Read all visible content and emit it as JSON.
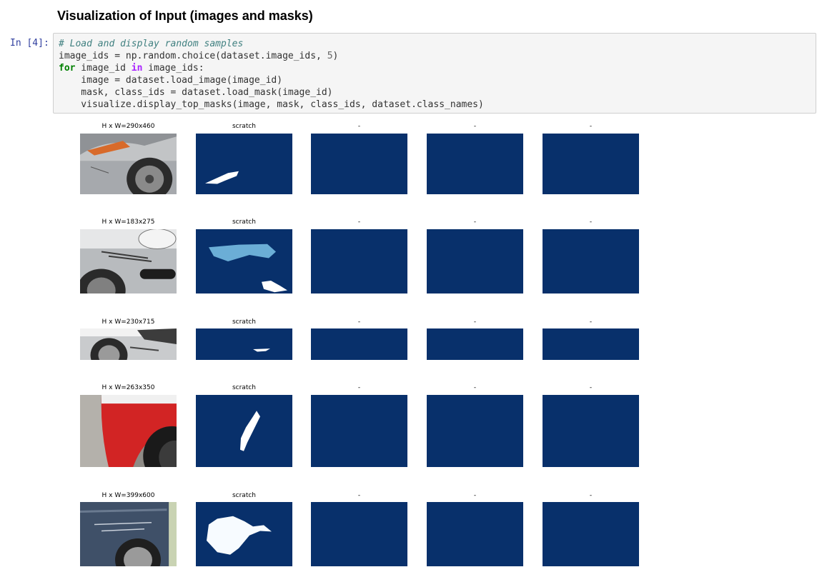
{
  "heading": "Visualization of Input (images and masks)",
  "cell": {
    "prompt": "In [4]:",
    "lines": [
      [
        {
          "t": "# Load and display random samples",
          "c": "tok-comment"
        }
      ],
      [
        {
          "t": "image_ids = np.random.choice(dataset.image_ids, ",
          "c": ""
        },
        {
          "t": "5",
          "c": "tok-num"
        },
        {
          "t": ")",
          "c": ""
        }
      ],
      [
        {
          "t": "for",
          "c": "tok-kw"
        },
        {
          "t": " image_id ",
          "c": ""
        },
        {
          "t": "in",
          "c": "tok-op"
        },
        {
          "t": " image_ids:",
          "c": ""
        }
      ],
      [
        {
          "t": "    image = dataset.load_image(image_id)",
          "c": ""
        }
      ],
      [
        {
          "t": "    mask, class_ids = dataset.load_mask(image_id)",
          "c": ""
        }
      ],
      [
        {
          "t": "    visualize.display_top_masks(image, mask, class_ids, dataset.class_names)",
          "c": ""
        }
      ]
    ]
  },
  "colors": {
    "mask_background": "#08306b",
    "mask_white": "#ffffff",
    "mask_light_blue": "#6baed6"
  },
  "rows": [
    {
      "image_title": "H x W=290x460",
      "mask_titles": [
        "scratch",
        "-",
        "-",
        "-",
        "-"
      ]
    },
    {
      "image_title": "H x W=183x275",
      "mask_titles": [
        "scratch",
        "-",
        "-",
        "-",
        "-"
      ]
    },
    {
      "image_title": "H x W=230x715",
      "mask_titles": [
        "scratch",
        "-",
        "-",
        "-",
        "-"
      ]
    },
    {
      "image_title": "H x W=263x350",
      "mask_titles": [
        "scratch",
        "-",
        "-",
        "-",
        "-"
      ]
    },
    {
      "image_title": "H x W=399x600",
      "mask_titles": [
        "scratch",
        "-",
        "-",
        "-",
        "-"
      ]
    }
  ]
}
